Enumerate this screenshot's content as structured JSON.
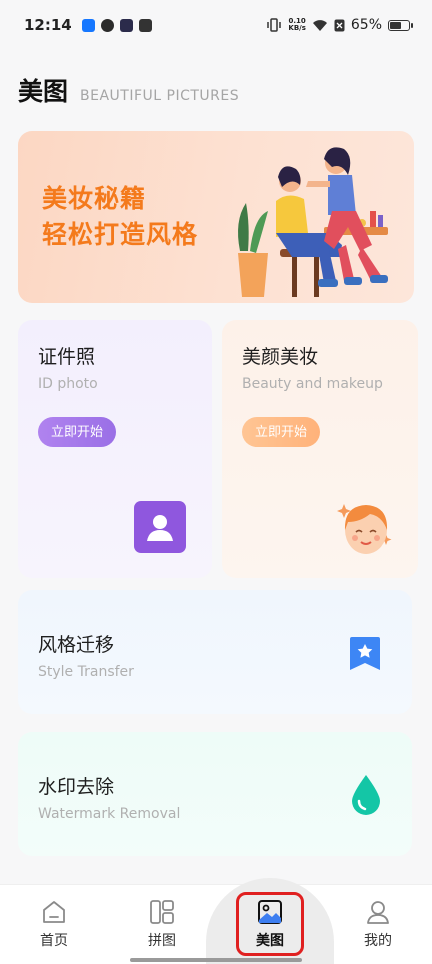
{
  "status_bar": {
    "time": "12:14",
    "net_speed_value": "0.10",
    "net_speed_unit": "KB/s",
    "battery": "65%",
    "battery_level": 0.65
  },
  "header": {
    "title": "美图",
    "subtitle": "BEAUTIFUL PICTURES"
  },
  "banner": {
    "line1": "美妆秘籍",
    "line2": "轻松打造风格"
  },
  "cards": {
    "id_photo": {
      "title": "证件照",
      "subtitle": "ID photo",
      "button": "立即开始",
      "icon": "portrait-icon"
    },
    "beauty": {
      "title": "美颜美妆",
      "subtitle": "Beauty and makeup",
      "button": "立即开始",
      "icon": "smiling-face-icon"
    },
    "style": {
      "title": "风格迁移",
      "subtitle": "Style Transfer",
      "icon": "bookmark-star-icon"
    },
    "watermark": {
      "title": "水印去除",
      "subtitle": "Watermark Removal",
      "icon": "water-drop-icon"
    }
  },
  "nav": {
    "items": [
      {
        "label": "首页",
        "icon": "home-icon"
      },
      {
        "label": "拼图",
        "icon": "collage-icon"
      },
      {
        "label": "美图",
        "icon": "image-icon",
        "active": true
      },
      {
        "label": "我的",
        "icon": "profile-icon"
      }
    ]
  },
  "colors": {
    "banner_text": "#f47a1c",
    "purple_button": "#9a6fe6",
    "orange_button": "#ffb27a",
    "style_icon": "#3d86f5",
    "water_icon": "#14c6a6",
    "highlight": "#e02020"
  }
}
